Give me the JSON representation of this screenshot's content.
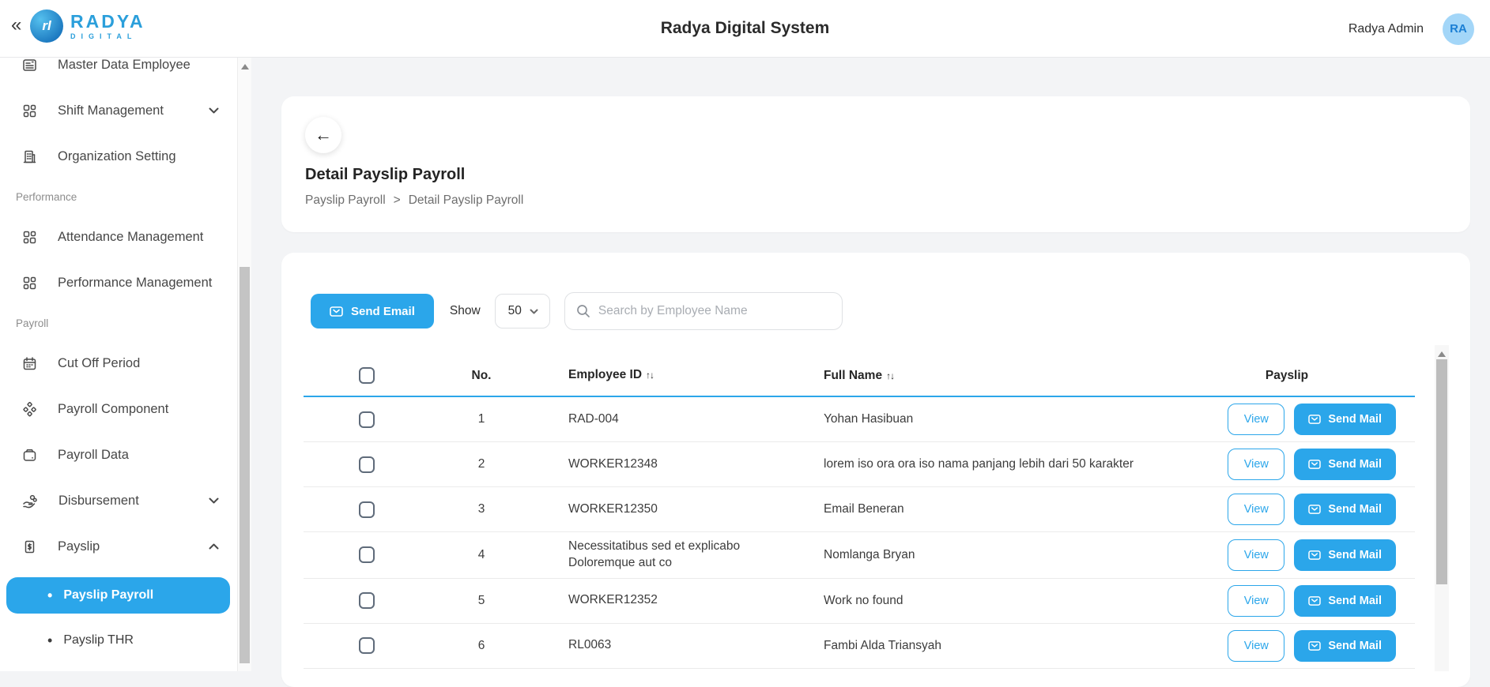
{
  "topbar": {
    "collapse_glyph": "«",
    "brand_monogram": "rl",
    "brand_top": "RADYA",
    "brand_bottom": "DIGITAL",
    "title": "Radya Digital System",
    "user_name": "Radya Admin",
    "avatar_initials": "RA"
  },
  "sidebar": {
    "master_data": "Master Data Employee",
    "shift": "Shift Management",
    "organization": "Organization Setting",
    "section_performance": "Performance",
    "attendance": "Attendance Management",
    "performance": "Performance Management",
    "section_payroll": "Payroll",
    "cutoff": "Cut Off Period",
    "component": "Payroll Component",
    "payroll_data": "Payroll Data",
    "disbursement": "Disbursement",
    "payslip": "Payslip",
    "payslip_payroll": "Payslip Payroll",
    "payslip_thr": "Payslip THR",
    "bullet": "•"
  },
  "header": {
    "back_glyph": "←",
    "title": "Detail Payslip Payroll",
    "breadcrumb_parent": "Payslip Payroll",
    "breadcrumb_separator": ">",
    "breadcrumb_current": "Detail Payslip Payroll"
  },
  "toolbar": {
    "send_email_label": "Send Email",
    "show_label": "Show",
    "page_size": "50",
    "search_placeholder": "Search by Employee Name"
  },
  "table": {
    "headers": {
      "no": "No.",
      "employee_id": "Employee ID",
      "full_name": "Full Name",
      "payslip": "Payslip",
      "sort_glyph": "↑↓"
    },
    "actions": {
      "view": "View",
      "send_mail": "Send Mail"
    },
    "rows": [
      {
        "no": "1",
        "employee_id": "RAD-004",
        "full_name": "Yohan Hasibuan"
      },
      {
        "no": "2",
        "employee_id": "WORKER12348",
        "full_name": "lorem iso ora ora iso nama panjang lebih dari 50 karakter"
      },
      {
        "no": "3",
        "employee_id": "WORKER12350",
        "full_name": "Email Beneran"
      },
      {
        "no": "4",
        "employee_id": "Necessitatibus sed et explicabo Doloremque aut co",
        "full_name": "Nomlanga Bryan"
      },
      {
        "no": "5",
        "employee_id": "WORKER12352",
        "full_name": "Work no found"
      },
      {
        "no": "6",
        "employee_id": "RL0063",
        "full_name": "Fambi Alda Triansyah"
      }
    ]
  },
  "colors": {
    "accent": "#2ba6ea",
    "avatar_bg": "#a3d6f8",
    "avatar_text": "#1b7fd4",
    "brand_blue": "#2b9fdb",
    "page_background": "#f3f4f6"
  }
}
